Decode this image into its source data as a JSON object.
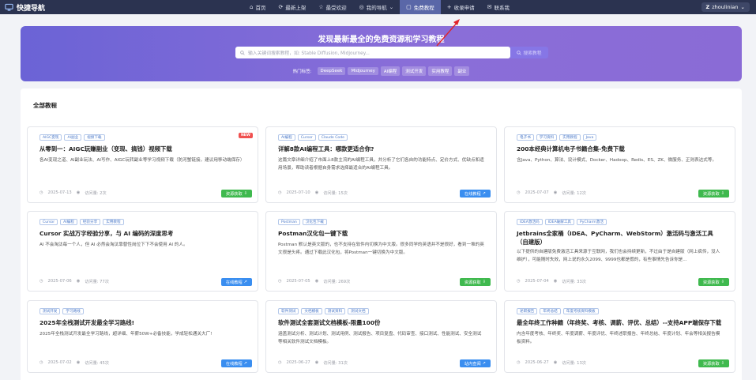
{
  "header": {
    "brand": "快捷导航",
    "nav": [
      {
        "icon": "⌂",
        "label": "首页"
      },
      {
        "icon": "⟳",
        "label": "最新上架"
      },
      {
        "icon": "☆",
        "label": "最受欢迎"
      },
      {
        "icon": "◎",
        "label": "我的导航"
      },
      {
        "icon": "▢",
        "label": "免费教程"
      },
      {
        "icon": "+",
        "label": "收录申请"
      },
      {
        "icon": "✉",
        "label": "联系我"
      }
    ],
    "user_initial": "Z",
    "user_name": "zhoulinian"
  },
  "hero": {
    "title": "发现最新最全的免费资源和学习教程",
    "search_placeholder": "输入关键词搜索教程，如: Stable Diffusion, Midjourney...",
    "search_button": "搜索教程",
    "hot_label": "热门标签:",
    "hot_tags": [
      "DeepSeek",
      "Midjourney",
      "AI编程",
      "测试开发",
      "实用教程",
      "副业"
    ]
  },
  "panel": {
    "title": "全部教程",
    "cards": [
      {
        "tags": [
          "AIGC变现",
          "AI副业",
          "视频下载"
        ],
        "title": "从零到一：AIGC玩赚副业（变现、搞钱）视频下载",
        "desc": "各AI变现之道、AI副业玩法、AI写作、AIGC玩转副业等学习视频下载（防河蟹链接，建议用移动端保存）",
        "date": "2025-07-13",
        "views": "访问量: 2次",
        "button": "资源获取",
        "badge": "NEW"
      },
      {
        "tags": [
          "AI编程",
          "Cursor",
          "Claude Code"
        ],
        "title": "详解8款AI编程工具：哪款更适合你?",
        "desc": "这篇文章详细介绍了市面上8款主流的AI编程工具，并分析了它们各自的功能特点、定价方式、优缺点和适用场景，帮助读者根据自身需求选择最适合的AI编程工具。",
        "date": "2025-07-10",
        "views": "访问量: 15次",
        "button": "在线教程"
      },
      {
        "tags": [
          "电子书",
          "学习资料",
          "实用教程",
          "Java"
        ],
        "title": "200本经典计算机电子书籍合集-免费下载",
        "desc": "含Java、Python、算法、设计模式、Docker、Hadoop、Redis、ES、ZK、微服务、正则表达式等。",
        "date": "2025-07-07",
        "views": "访问量: 12次",
        "button": "资源获取"
      },
      {
        "tags": [
          "Cursor",
          "AI编程",
          "经验分享",
          "实用教程"
        ],
        "title": "Cursor 实战万字经验分享，与 AI 编码的深度思考",
        "desc": "AI 不会淘汰每一个人，但 AI 必然会淘汰靠替性岗位下下不会使用 AI 的人。",
        "date": "2025-07-06",
        "views": "访问量: 77次",
        "button": "在线教程"
      },
      {
        "tags": [
          "Postman",
          "汉化包下载"
        ],
        "title": "Postman汉化包一键下载",
        "desc": "Postman 默认是英文版的，也不支持在软件内切换为中文版。很多同学的英语并不是很好，看到一堆的英文很是头疼。通过下载此汉化包，将Postman一键切换为中文版。",
        "date": "2025-07-05",
        "views": "访问量: 269次",
        "button": "资源获取"
      },
      {
        "tags": [
          "IDEA激活码",
          "IDEA破解工具",
          "PyCharm激活"
        ],
        "title": "Jetbrains全家桶（IDEA、PyCharm、WebStorm）激活码与激活工具（自建版）",
        "desc": "以下提供的自建版免费激活工具来源于互联网，我们也会持续更新，不过由于是自建版（网上疯传，没人维护），可能随时失效，网上说的永久2099、9999也都是假的，有些事情先告诉你是...",
        "date": "2025-07-04",
        "views": "访问量: 33次",
        "button": "资源获取"
      },
      {
        "tags": [
          "测试开发",
          "学习路线"
        ],
        "title": "2025年全栈测试开发最全学习路线!",
        "desc": "2025年全栈测试开发最全学习路线，超详细、年薪50W+必备技能，学成轻松通关大厂!",
        "date": "2025-07-02",
        "views": "访问量: 45次",
        "button": "在线教程"
      },
      {
        "tags": [
          "软件测试",
          "文档模板",
          "测试资料",
          "测试文档"
        ],
        "title": "软件测试全套测试文档模板-限量100份",
        "desc": "涵盖测试分析、测试计划、测试用例、测试报告、项目复盘、代码审查、接口测试、性能测试、安全测试等相关软件测试文档模板。",
        "date": "2025-06-27",
        "views": "访问量: 31次",
        "button": "站内查阅"
      },
      {
        "tags": [
          "述职报告",
          "年终总结",
          "年度考核资料模板"
        ],
        "title": "最全年终工作种籍（年终奖、考核、调薪、评优、总结）--支持APP端保存下载",
        "desc": "内含年度考核、年终奖、年度调薪、年度评优、年终述职报告、年终总结、年度计划、年会等相关报告模板资料。",
        "date": "2025-06-27",
        "views": "访问量: 13次",
        "button": "资源获取"
      }
    ]
  },
  "colors": {
    "topbar": "#2b3350",
    "nav_active": "#5a67a8",
    "hero_start": "#6b63d6",
    "hero_end": "#8a6bd6",
    "button_green": "#3fb94e",
    "button_blue": "#3a8ef0",
    "badge_red": "#f0504f",
    "annotation_arrow": "#e0242b"
  },
  "icons": {
    "brand": "monitor-icon",
    "search": "search-icon",
    "date": "clock-icon",
    "views": "eye-icon",
    "download": "download-icon",
    "external": "external-link-icon",
    "user_menu": "chevron-down-icon"
  }
}
